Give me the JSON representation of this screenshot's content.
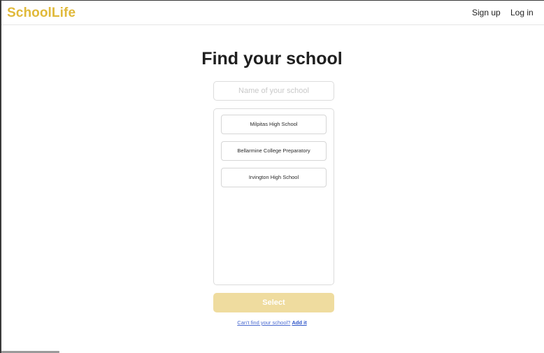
{
  "header": {
    "brand": "SchoolLife",
    "signup_label": "Sign up",
    "login_label": "Log in"
  },
  "main": {
    "title": "Find your school",
    "search_placeholder": "Name of your school",
    "search_value": "",
    "schools": [
      "Milpitas High School",
      "Bellarmine College Preparatory",
      "Irvington High School"
    ],
    "select_label": "Select",
    "help_text": "Can't find your school?",
    "help_link": "Add it"
  },
  "colors": {
    "brand": "#e0b93a",
    "select_button": "#efdc9f",
    "link": "#2f56c9"
  }
}
